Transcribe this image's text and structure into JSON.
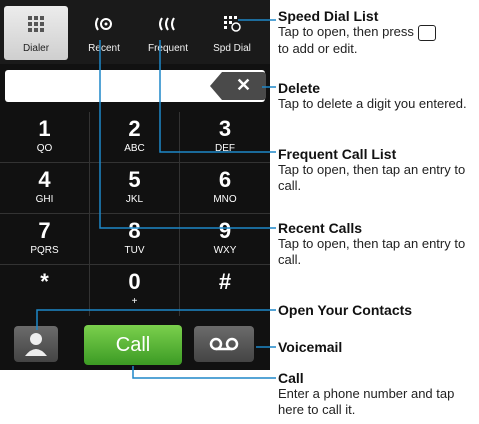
{
  "tabs": [
    {
      "label": "Dialer"
    },
    {
      "label": "Recent"
    },
    {
      "label": "Frequent"
    },
    {
      "label": "Spd Dial"
    }
  ],
  "keypad": [
    {
      "digit": "1",
      "letters": "QO"
    },
    {
      "digit": "2",
      "letters": "ABC"
    },
    {
      "digit": "3",
      "letters": "DEF"
    },
    {
      "digit": "4",
      "letters": "GHI"
    },
    {
      "digit": "5",
      "letters": "JKL"
    },
    {
      "digit": "6",
      "letters": "MNO"
    },
    {
      "digit": "7",
      "letters": "PQRS"
    },
    {
      "digit": "8",
      "letters": "TUV"
    },
    {
      "digit": "9",
      "letters": "WXY"
    },
    {
      "digit": "*",
      "letters": ""
    },
    {
      "digit": "0",
      "letters": "+"
    },
    {
      "digit": "#",
      "letters": ""
    }
  ],
  "call_button": "Call",
  "delete_glyph": "✕",
  "callouts": {
    "speed_dial": {
      "title": "Speed Dial List",
      "desc_a": "Tap to open, then press",
      "desc_b": "to add or edit."
    },
    "delete": {
      "title": "Delete",
      "desc": "Tap to delete a digit you entered."
    },
    "frequent": {
      "title": "Frequent Call List",
      "desc": "Tap to open, then tap an entry to call."
    },
    "recent": {
      "title": "Recent Calls",
      "desc": "Tap to open, then tap an entry to call."
    },
    "contacts": {
      "title": "Open Your Contacts"
    },
    "voicemail": {
      "title": "Voicemail"
    },
    "call": {
      "title": "Call",
      "desc": "Enter a phone number and tap here to call it."
    }
  },
  "colors": {
    "call_green": "#4caf2e",
    "phone_bg": "#111111",
    "line": "#1e87c8"
  }
}
